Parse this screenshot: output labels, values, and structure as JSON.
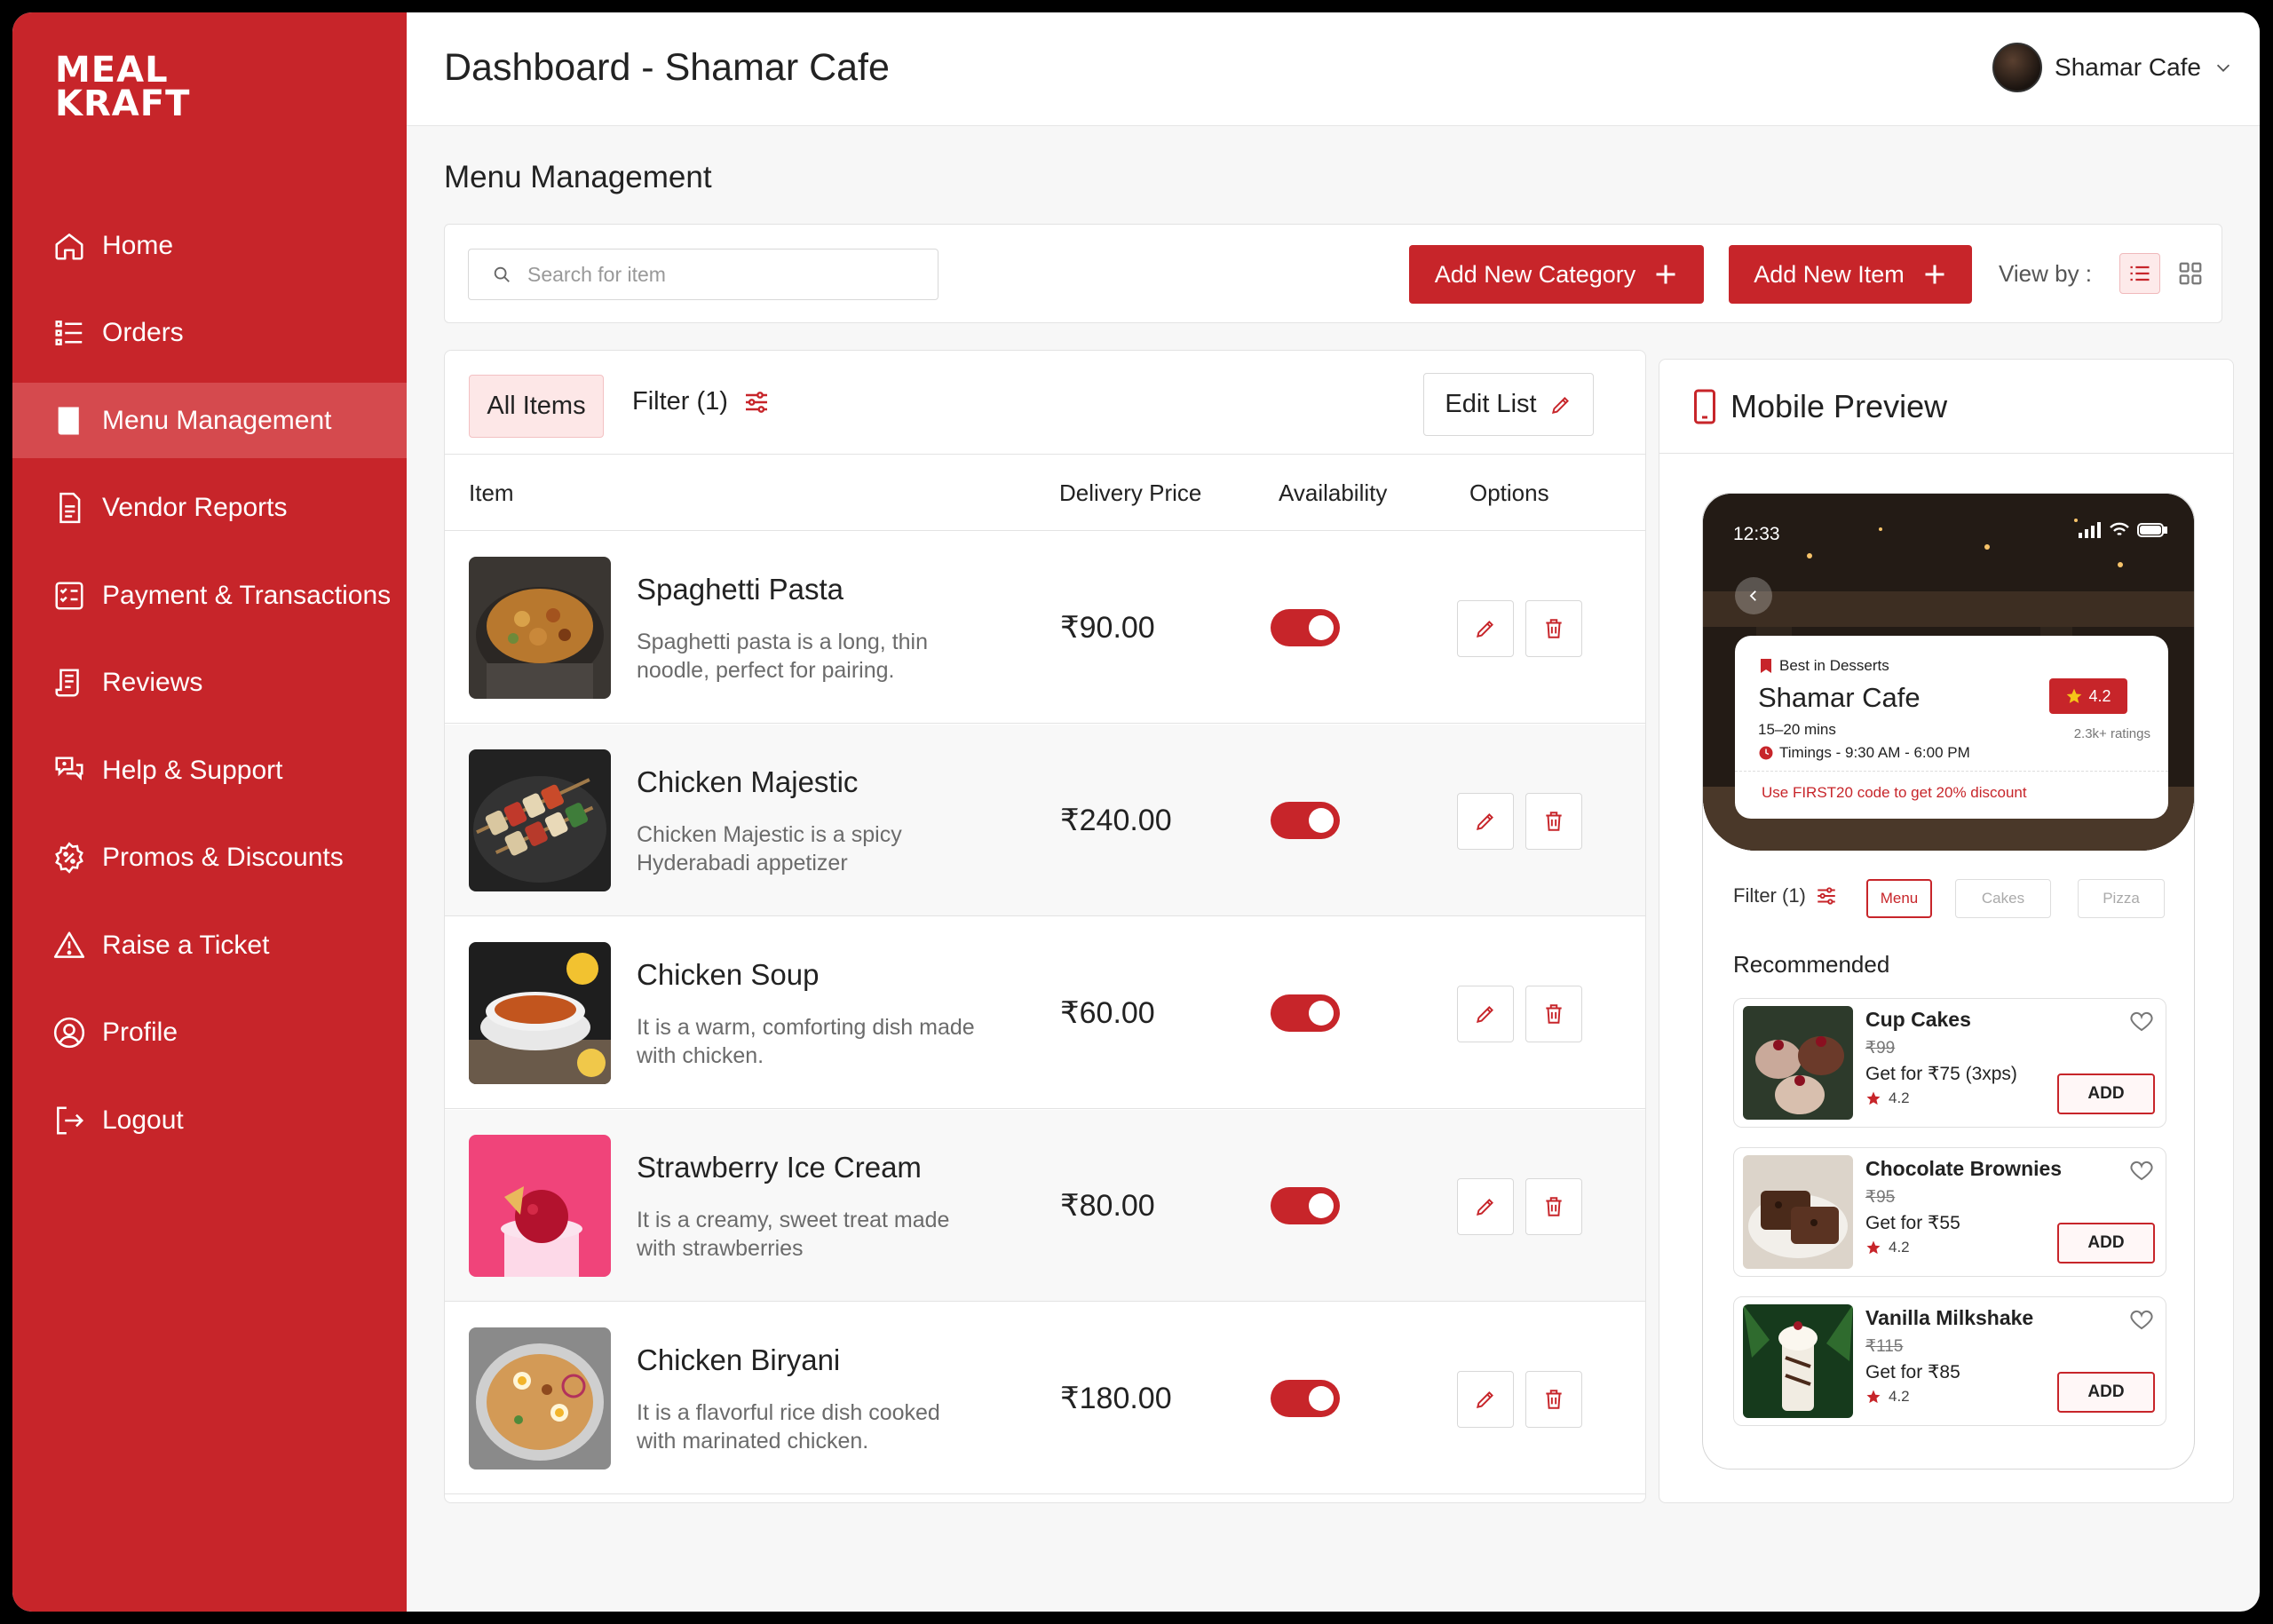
{
  "brand": {
    "logo_line1": "MEAL",
    "logo_line2": "KRAFT"
  },
  "sidebar": {
    "items": [
      {
        "label": "Home",
        "icon": "home-icon"
      },
      {
        "label": "Orders",
        "icon": "orders-icon"
      },
      {
        "label": "Menu Management",
        "icon": "menu-book-icon",
        "active": true
      },
      {
        "label": "Vendor Reports",
        "icon": "report-icon"
      },
      {
        "label": "Payment & Transactions",
        "icon": "payment-icon"
      },
      {
        "label": "Reviews",
        "icon": "reviews-icon"
      },
      {
        "label": "Help & Support",
        "icon": "help-icon"
      },
      {
        "label": "Promos & Discounts",
        "icon": "promo-icon"
      },
      {
        "label": "Raise a Ticket",
        "icon": "warning-icon"
      },
      {
        "label": "Profile",
        "icon": "profile-icon"
      },
      {
        "label": "Logout",
        "icon": "logout-icon"
      }
    ]
  },
  "header": {
    "title": "Dashboard  - Shamar Cafe",
    "user_name": "Shamar Cafe"
  },
  "page": {
    "section_title": "Menu Management"
  },
  "toolbar": {
    "search_placeholder": "Search for item",
    "add_category_label": "Add New Category",
    "add_item_label": "Add New Item",
    "view_by_label": "View by :",
    "view_selected": "list"
  },
  "table": {
    "tab_all": "All Items",
    "tab_filter": "Filter (1)",
    "edit_list": "Edit List",
    "columns": [
      "Item",
      "Delivery Price",
      "Availability",
      "Options"
    ],
    "rows": [
      {
        "name": "Spaghetti Pasta",
        "desc": "Spaghetti pasta is a long, thin noodle, perfect for pairing.",
        "price": "₹90.00",
        "available": true
      },
      {
        "name": "Chicken Majestic",
        "desc": "Chicken Majestic is a spicy Hyderabadi appetizer",
        "price": "₹240.00",
        "available": true
      },
      {
        "name": "Chicken Soup",
        "desc": "It is a warm, comforting dish made with chicken.",
        "price": "₹60.00",
        "available": true
      },
      {
        "name": "Strawberry Ice Cream",
        "desc": "It is a creamy, sweet treat made with strawberries",
        "price": "₹80.00",
        "available": true
      },
      {
        "name": "Chicken Biryani",
        "desc": "It is a flavorful rice dish cooked with marinated chicken.",
        "price": "₹180.00",
        "available": true
      }
    ]
  },
  "preview": {
    "title": "Mobile Preview",
    "status_time": "12:33",
    "badge": "Best in Desserts",
    "cafe_name": "Shamar Cafe",
    "rating": "4.2",
    "ratings_count": "2.3k+ ratings",
    "mins": "15–20 mins",
    "timings": "Timings - 9:30 AM - 6:00 PM",
    "promo": "Use FIRST20 code to get 20% discount",
    "filter_label": "Filter (1)",
    "chips": [
      "Menu",
      "Cakes",
      "Pizza"
    ],
    "recommended_title": "Recommended",
    "add_label": "ADD",
    "items": [
      {
        "name": "Cup Cakes",
        "old_price": "₹99",
        "offer": "Get for ₹75 (3xps)",
        "rating": "4.2"
      },
      {
        "name": "Chocolate Brownies",
        "old_price": "₹95",
        "offer": "Get for ₹55",
        "rating": "4.2"
      },
      {
        "name": "Vanilla Milkshake",
        "old_price": "₹115",
        "offer": "Get for ₹85",
        "rating": "4.2"
      }
    ]
  },
  "colors": {
    "accent": "#c7252a",
    "sidebar_active": "#d54a4e",
    "background": "#f7f7f7"
  }
}
